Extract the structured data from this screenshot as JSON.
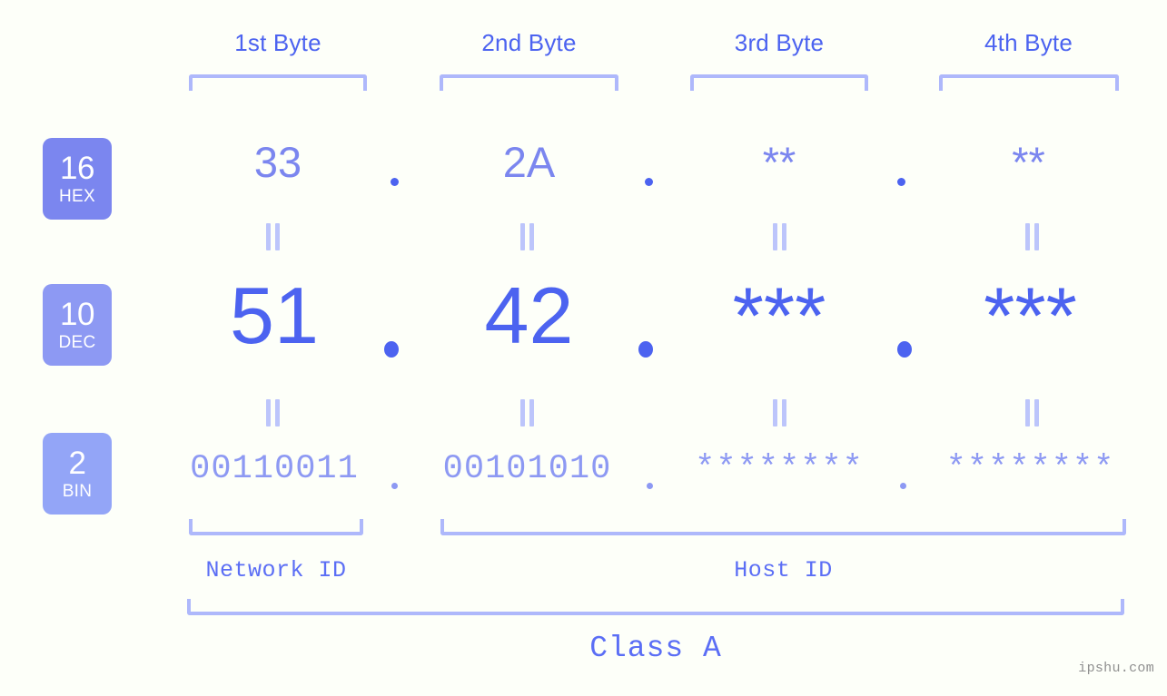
{
  "background_color": "#fdfff9",
  "accent_colors": {
    "strong_blue": "#4c63f0",
    "mid_blue": "#7b86ef",
    "light_blue": "#8d99f3",
    "pale_blue": "#aeb8fb",
    "bracket": "#aeb8fb",
    "watermark_gray": "#8f8f8f"
  },
  "byte_headers": [
    {
      "label": "1st Byte"
    },
    {
      "label": "2nd Byte"
    },
    {
      "label": "3rd Byte"
    },
    {
      "label": "4th Byte"
    }
  ],
  "bases": [
    {
      "number": "16",
      "name": "HEX",
      "color": "#7b86ef"
    },
    {
      "number": "10",
      "name": "DEC",
      "color": "#8d99f3"
    },
    {
      "number": "2",
      "name": "BIN",
      "color": "#93a5f7"
    }
  ],
  "rows": {
    "hex": {
      "values": [
        "33",
        "2A",
        "**",
        "**"
      ],
      "separator": "."
    },
    "dec": {
      "values": [
        "51",
        "42",
        "***",
        "***"
      ],
      "separator": "."
    },
    "bin": {
      "values": [
        "00110011",
        "00101010",
        "********",
        "********"
      ],
      "separator": "."
    }
  },
  "equals_symbol": "=",
  "segments": {
    "network": {
      "label": "Network ID"
    },
    "host": {
      "label": "Host ID"
    },
    "class": {
      "label": "Class A"
    }
  },
  "watermark": "ipshu.com"
}
